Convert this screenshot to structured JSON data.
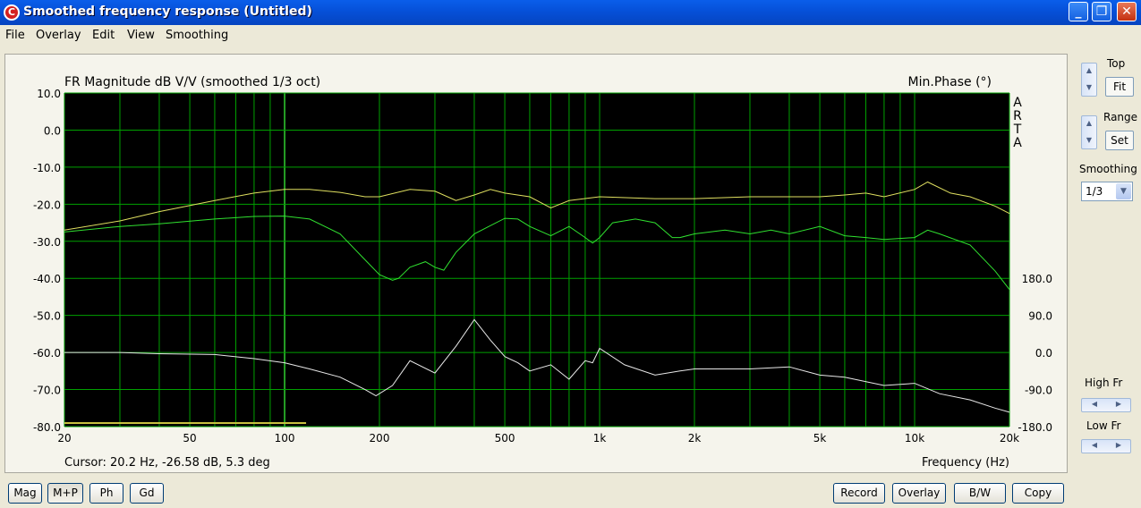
{
  "window": {
    "title": "Smoothed frequency response (Untitled)",
    "app_icon_glyph": "C",
    "minimize_glyph": "_",
    "restore_glyph": "❐",
    "close_glyph": "✕"
  },
  "menu": [
    "File",
    "Overlay",
    "Edit",
    "View",
    "Smoothing"
  ],
  "plot": {
    "left_title": "FR Magnitude dB V/V (smoothed 1/3 oct)",
    "right_title": "Min.Phase (°)",
    "watermark": [
      "A",
      "R",
      "T",
      "A"
    ],
    "cursor_text": "Cursor: 20.2 Hz, -26.58 dB, 5.3 deg",
    "x_axis_label": "Frequency (Hz)",
    "background": "#000000",
    "grid_color": "#00A000",
    "left_ticks": [
      "10.0",
      "0.0",
      "-10.0",
      "-20.0",
      "-30.0",
      "-40.0",
      "-50.0",
      "-60.0",
      "-70.0",
      "-80.0"
    ],
    "right_ticks": [
      {
        "label": "180.0",
        "db": -40
      },
      {
        "label": "90.0",
        "db": -50
      },
      {
        "label": "0.0",
        "db": -60
      },
      {
        "label": "-90.0",
        "db": -70
      },
      {
        "label": "-180.0",
        "db": -80
      }
    ],
    "x_ticks": [
      "20",
      "50",
      "100",
      "200",
      "500",
      "1k",
      "2k",
      "5k",
      "10k",
      "20k"
    ]
  },
  "chart_data": {
    "type": "line",
    "x_scale": "log",
    "xlim": [
      20,
      20000
    ],
    "ylim": [
      -80,
      10
    ],
    "y2lim": [
      -180,
      180
    ],
    "series": [
      {
        "color": "#E0E060",
        "axis": "left",
        "x": [
          20,
          30,
          40,
          60,
          80,
          100,
          120,
          150,
          180,
          200,
          250,
          300,
          350,
          400,
          450,
          500,
          600,
          700,
          800,
          1000,
          1500,
          2000,
          3000,
          4000,
          5000,
          6000,
          7000,
          8000,
          10000,
          11000,
          13000,
          15000,
          18000,
          20000
        ],
        "y": [
          -27,
          -24.5,
          -22,
          -19,
          -17,
          -16,
          -16,
          -16.8,
          -18,
          -18,
          -16,
          -16.5,
          -19,
          -17.5,
          -16,
          -17,
          -18,
          -21,
          -19,
          -18,
          -18.5,
          -18.5,
          -18,
          -18,
          -18,
          -17.5,
          -17,
          -18,
          -16,
          -14,
          -17,
          -18,
          -20.5,
          -22.5
        ]
      },
      {
        "color": "#30E030",
        "axis": "left",
        "x": [
          20,
          30,
          40,
          60,
          80,
          100,
          120,
          150,
          180,
          200,
          220,
          230,
          250,
          280,
          300,
          320,
          350,
          400,
          500,
          550,
          600,
          700,
          800,
          900,
          950,
          1000,
          1100,
          1300,
          1500,
          1700,
          1800,
          2000,
          2500,
          3000,
          3500,
          4000,
          5000,
          6000,
          7000,
          8000,
          10000,
          11000,
          12000,
          15000,
          18000,
          20000
        ],
        "y": [
          -27.5,
          -26,
          -25.3,
          -24,
          -23.3,
          -23.2,
          -24,
          -28,
          -35,
          -39,
          -40.5,
          -40,
          -37,
          -35.5,
          -37,
          -37.8,
          -33,
          -28,
          -23.8,
          -24,
          -26,
          -28.5,
          -26,
          -29,
          -30.5,
          -29,
          -25,
          -24,
          -25,
          -29,
          -29,
          -28,
          -27,
          -28,
          -27,
          -28,
          -26,
          -28.5,
          -29,
          -29.5,
          -29,
          -27,
          -28,
          -31,
          -38,
          -43
        ]
      },
      {
        "color": "#E8E8E8",
        "axis": "right",
        "x": [
          20,
          30,
          40,
          60,
          80,
          100,
          120,
          150,
          180,
          195,
          220,
          250,
          300,
          350,
          400,
          450,
          500,
          550,
          600,
          700,
          800,
          900,
          950,
          1000,
          1200,
          1500,
          1800,
          2000,
          2500,
          3000,
          4000,
          5000,
          6000,
          8000,
          10000,
          12000,
          15000,
          18000,
          20000
        ],
        "y": [
          0,
          0,
          -3,
          -5,
          -15,
          -25,
          -40,
          -60,
          -90,
          -105,
          -80,
          -20,
          -50,
          15,
          80,
          30,
          -10,
          -25,
          -45,
          -30,
          -65,
          -20,
          -25,
          10,
          -30,
          -55,
          -45,
          -40,
          -40,
          -40,
          -35,
          -55,
          -60,
          -80,
          -75,
          -100,
          -115,
          -135,
          -145
        ]
      }
    ]
  },
  "side_panel": {
    "top_label": "Top",
    "fit_label": "Fit",
    "range_label": "Range",
    "set_label": "Set",
    "smoothing_label": "Smoothing",
    "smoothing_value": "1/3",
    "high_fr_label": "High Fr",
    "low_fr_label": "Low Fr",
    "arrow_up": "▲",
    "arrow_down": "▼",
    "arrow_left": "◀",
    "arrow_right": "▶",
    "dropdown_glyph": "▼"
  },
  "bottom_left_buttons": [
    "Mag",
    "M+P",
    "Ph",
    "Gd"
  ],
  "bottom_right_buttons": [
    "Record",
    "Overlay",
    "B/W",
    "Copy"
  ]
}
